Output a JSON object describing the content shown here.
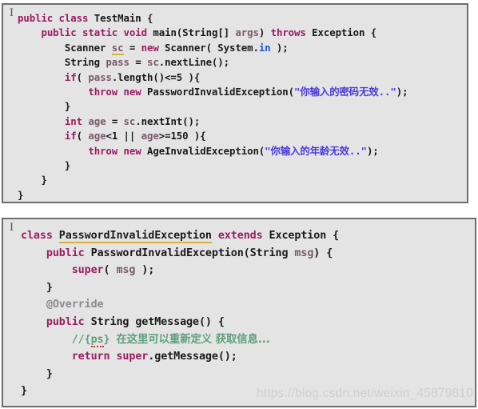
{
  "app": {
    "kind": "java-code-editor-screenshot",
    "cursor_glyph": "I"
  },
  "colors": {
    "panel_background": "#e4e4e4",
    "panel_border": "#6d6d6d",
    "keyword": "#9b1c61",
    "type": "#1a1a1a",
    "variable": "#7c5a6b",
    "static_field": "#1a57d6",
    "string": "#4a3adb",
    "comment": "#5fa07a",
    "annotation": "#8a8a8a",
    "warning_underline": "#d8b23a",
    "spellcheck_underline": "#c43b2f",
    "watermark": "#cfcfcf"
  },
  "panels": [
    {
      "id": "test-main",
      "lines": [
        {
          "id": "l1",
          "text": "public class TestMain {",
          "tokens": [
            {
              "t": "public",
              "c": "kw"
            },
            {
              "t": " ",
              "c": "typ"
            },
            {
              "t": "class",
              "c": "kw"
            },
            {
              "t": " TestMain {",
              "c": "typ"
            }
          ]
        },
        {
          "id": "l2",
          "text": "    public static void main(String[] args) throws Exception {",
          "tokens": [
            {
              "t": "    ",
              "c": "typ"
            },
            {
              "t": "public",
              "c": "kw"
            },
            {
              "t": " ",
              "c": "typ"
            },
            {
              "t": "static",
              "c": "kw"
            },
            {
              "t": " ",
              "c": "typ"
            },
            {
              "t": "void",
              "c": "kw"
            },
            {
              "t": " main(String[] ",
              "c": "typ"
            },
            {
              "t": "args",
              "c": "var"
            },
            {
              "t": ") ",
              "c": "typ"
            },
            {
              "t": "throws",
              "c": "kw"
            },
            {
              "t": " Exception {",
              "c": "typ"
            }
          ]
        },
        {
          "id": "l3",
          "text": "        Scanner sc = new Scanner( System.in );",
          "tokens": [
            {
              "t": "        Scanner ",
              "c": "typ"
            },
            {
              "t": "sc",
              "c": "var warn"
            },
            {
              "t": " = ",
              "c": "typ"
            },
            {
              "t": "new",
              "c": "kw"
            },
            {
              "t": " Scanner( System.",
              "c": "typ"
            },
            {
              "t": "in",
              "c": "fld"
            },
            {
              "t": " );",
              "c": "typ"
            }
          ]
        },
        {
          "id": "l4",
          "text": "        String pass = sc.nextLine();",
          "tokens": [
            {
              "t": "        String ",
              "c": "typ"
            },
            {
              "t": "pass",
              "c": "var"
            },
            {
              "t": " = ",
              "c": "typ"
            },
            {
              "t": "sc",
              "c": "var"
            },
            {
              "t": ".nextLine();",
              "c": "typ"
            }
          ]
        },
        {
          "id": "l5",
          "text": "        if( pass.length()<=5 ){",
          "tokens": [
            {
              "t": "        ",
              "c": "typ"
            },
            {
              "t": "if",
              "c": "kw"
            },
            {
              "t": "( ",
              "c": "typ"
            },
            {
              "t": "pass",
              "c": "var"
            },
            {
              "t": ".length()<=5 ){",
              "c": "typ"
            }
          ]
        },
        {
          "id": "l6",
          "text": "            throw new PasswordInvalidException(\"你输入的密码无效..\");",
          "tokens": [
            {
              "t": "            ",
              "c": "typ"
            },
            {
              "t": "throw",
              "c": "kw"
            },
            {
              "t": " ",
              "c": "typ"
            },
            {
              "t": "new",
              "c": "kw"
            },
            {
              "t": " PasswordInvalidException(",
              "c": "typ"
            },
            {
              "t": "\"你输入的密码无效..\"",
              "c": "str"
            },
            {
              "t": ");",
              "c": "typ"
            }
          ]
        },
        {
          "id": "l7",
          "text": "        }",
          "tokens": [
            {
              "t": "        }",
              "c": "typ"
            }
          ]
        },
        {
          "id": "l8",
          "text": "        int age = sc.nextInt();",
          "tokens": [
            {
              "t": "        ",
              "c": "typ"
            },
            {
              "t": "int",
              "c": "kw"
            },
            {
              "t": " ",
              "c": "typ"
            },
            {
              "t": "age",
              "c": "var"
            },
            {
              "t": " = ",
              "c": "typ"
            },
            {
              "t": "sc",
              "c": "var"
            },
            {
              "t": ".nextInt();",
              "c": "typ"
            }
          ]
        },
        {
          "id": "l9",
          "text": "        if( age<1 || age>=150 ){",
          "tokens": [
            {
              "t": "        ",
              "c": "typ"
            },
            {
              "t": "if",
              "c": "kw"
            },
            {
              "t": "( ",
              "c": "typ"
            },
            {
              "t": "age",
              "c": "var"
            },
            {
              "t": "<1 || ",
              "c": "typ"
            },
            {
              "t": "age",
              "c": "var"
            },
            {
              "t": ">=150 ){",
              "c": "typ"
            }
          ]
        },
        {
          "id": "l10",
          "text": "            throw new AgeInvalidException(\"你输入的年龄无效..\");",
          "tokens": [
            {
              "t": "            ",
              "c": "typ"
            },
            {
              "t": "throw",
              "c": "kw"
            },
            {
              "t": " ",
              "c": "typ"
            },
            {
              "t": "new",
              "c": "kw"
            },
            {
              "t": " AgeInvalidException(",
              "c": "typ"
            },
            {
              "t": "\"你输入的年龄无效..\"",
              "c": "str"
            },
            {
              "t": ");",
              "c": "typ"
            }
          ]
        },
        {
          "id": "l11",
          "text": "        }",
          "tokens": [
            {
              "t": "        }",
              "c": "typ"
            }
          ]
        },
        {
          "id": "l12",
          "text": "    }",
          "tokens": [
            {
              "t": "    }",
              "c": "typ"
            }
          ]
        },
        {
          "id": "l13",
          "text": "}",
          "tokens": [
            {
              "t": "}",
              "c": "typ"
            }
          ]
        }
      ]
    },
    {
      "id": "password-invalid-exception",
      "lines": [
        {
          "id": "b1",
          "text": "class PasswordInvalidException extends Exception {",
          "tokens": [
            {
              "t": "class",
              "c": "kw"
            },
            {
              "t": " ",
              "c": "typ"
            },
            {
              "t": "PasswordInvalidException",
              "c": "typ warn"
            },
            {
              "t": " ",
              "c": "typ"
            },
            {
              "t": "extends",
              "c": "kw"
            },
            {
              "t": " Exception {",
              "c": "typ"
            }
          ]
        },
        {
          "id": "b2",
          "text": "    public PasswordInvalidException(String msg) {",
          "tokens": [
            {
              "t": "    ",
              "c": "typ"
            },
            {
              "t": "public",
              "c": "kw"
            },
            {
              "t": " PasswordInvalidException(String ",
              "c": "typ"
            },
            {
              "t": "msg",
              "c": "var"
            },
            {
              "t": ") {",
              "c": "typ"
            }
          ]
        },
        {
          "id": "b3",
          "text": "        super( msg );",
          "tokens": [
            {
              "t": "        ",
              "c": "typ"
            },
            {
              "t": "super",
              "c": "kw"
            },
            {
              "t": "( ",
              "c": "typ"
            },
            {
              "t": "msg",
              "c": "var"
            },
            {
              "t": " );",
              "c": "typ"
            }
          ]
        },
        {
          "id": "b4",
          "text": "    }",
          "tokens": [
            {
              "t": "    }",
              "c": "typ"
            }
          ]
        },
        {
          "id": "b5",
          "text": "    @Override",
          "tokens": [
            {
              "t": "    ",
              "c": "typ"
            },
            {
              "t": "@Override",
              "c": "ann"
            }
          ]
        },
        {
          "id": "b6",
          "text": "    public String getMessage() {",
          "tokens": [
            {
              "t": "    ",
              "c": "typ"
            },
            {
              "t": "public",
              "c": "kw"
            },
            {
              "t": " String getMessage() {",
              "c": "typ"
            }
          ]
        },
        {
          "id": "b7",
          "text": "        //{ps} 在这里可以重新定义 获取信息...",
          "tokens": [
            {
              "t": "        ",
              "c": "typ"
            },
            {
              "t": "//{",
              "c": "cmt"
            },
            {
              "t": "ps",
              "c": "cmt spell"
            },
            {
              "t": "} ",
              "c": "cmt"
            },
            {
              "t": "在这里可以重新定义 获取信息...",
              "c": "cmt cjk"
            }
          ]
        },
        {
          "id": "b8",
          "text": "        return super.getMessage();",
          "tokens": [
            {
              "t": "        ",
              "c": "typ"
            },
            {
              "t": "return",
              "c": "kw"
            },
            {
              "t": " ",
              "c": "typ"
            },
            {
              "t": "super",
              "c": "kw"
            },
            {
              "t": ".getMessage();",
              "c": "typ"
            }
          ]
        },
        {
          "id": "b9",
          "text": "    }",
          "tokens": [
            {
              "t": "    }",
              "c": "typ"
            }
          ]
        },
        {
          "id": "b10",
          "text": "}",
          "tokens": [
            {
              "t": "}",
              "c": "typ"
            }
          ]
        }
      ]
    }
  ],
  "watermark": {
    "text": "https://blog.csdn.net/weixin_45879810"
  }
}
